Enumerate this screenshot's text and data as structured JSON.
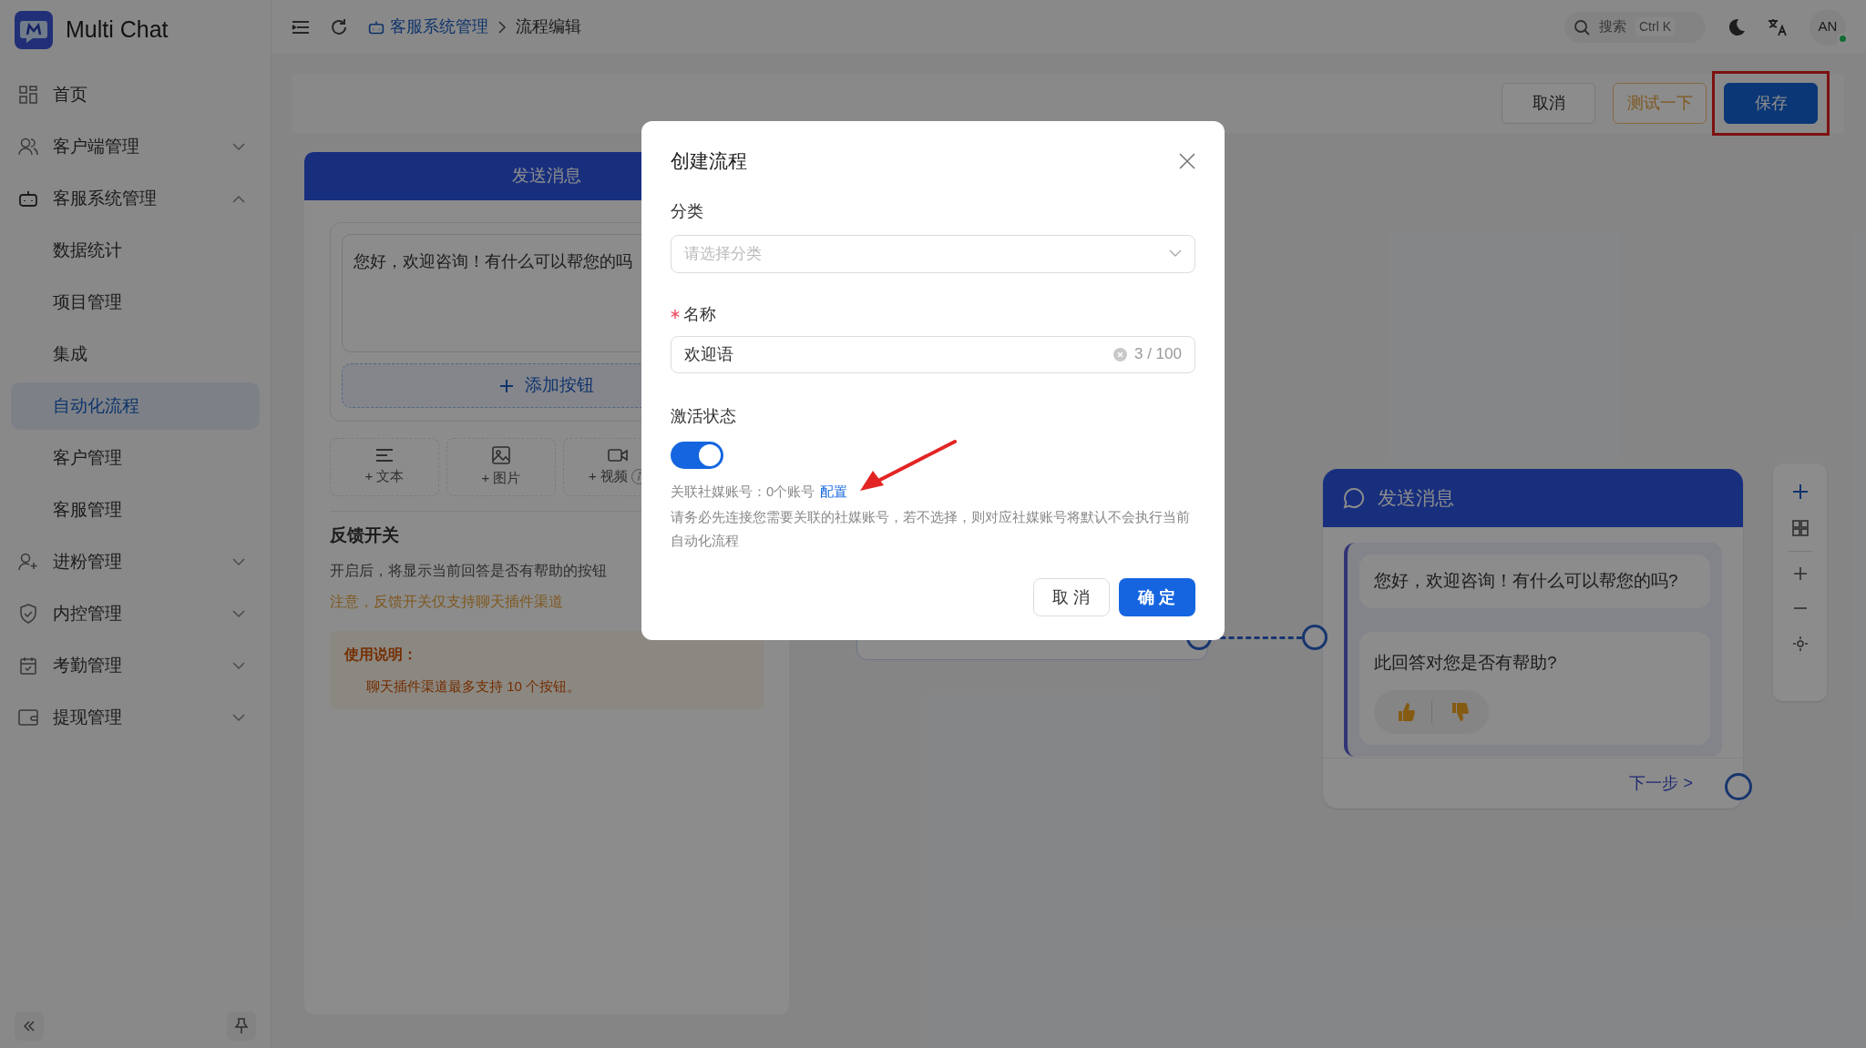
{
  "app": {
    "name": "Multi Chat"
  },
  "sidebar": {
    "items": [
      {
        "label": "首页"
      },
      {
        "label": "客户端管理",
        "expanded": false
      },
      {
        "label": "客服系统管理",
        "expanded": true,
        "children": [
          {
            "label": "数据统计",
            "selected": false
          },
          {
            "label": "项目管理",
            "selected": false
          },
          {
            "label": "集成",
            "selected": false
          },
          {
            "label": "自动化流程",
            "selected": true
          },
          {
            "label": "客户管理",
            "selected": false
          },
          {
            "label": "客服管理",
            "selected": false
          }
        ]
      },
      {
        "label": "进粉管理",
        "expanded": false
      },
      {
        "label": "内控管理",
        "expanded": false
      },
      {
        "label": "考勤管理",
        "expanded": false
      },
      {
        "label": "提现管理",
        "expanded": false
      }
    ]
  },
  "topbar": {
    "breadcrumb": [
      {
        "label": "客服系统管理",
        "link": true
      },
      {
        "label": "流程编辑",
        "link": false
      }
    ],
    "search": {
      "placeholder": "搜索",
      "shortcut": "Ctrl K"
    },
    "avatar": "AN"
  },
  "toolbar": {
    "buttons": [
      {
        "label": "取消",
        "kind": "plain",
        "highlighted": false
      },
      {
        "label": "测试一下",
        "kind": "warning",
        "highlighted": false
      },
      {
        "label": "保存",
        "kind": "primary",
        "highlighted": true
      }
    ]
  },
  "editor": {
    "title": "发送消息",
    "message": "您好，欢迎咨询！有什么可以帮您的吗",
    "add_button": "添加按钮",
    "media": [
      {
        "label": "+ 文本",
        "kind": "text",
        "info": false
      },
      {
        "label": "+ 图片",
        "kind": "image",
        "info": false
      },
      {
        "label": "+ 视频",
        "kind": "video",
        "info": true
      }
    ],
    "feedback": {
      "title": "反馈开关",
      "description": "开启后，将显示当前回答是否有帮助的按钮",
      "warning": "注意，反馈开关仅支持聊天插件渠道"
    },
    "usage": {
      "title": "使用说明：",
      "items": [
        "聊天插件渠道最多支持 10 个按钮。"
      ]
    }
  },
  "canvas": {
    "node": {
      "title": "发送消息",
      "message": "您好，欢迎咨询！有什么可以帮您的吗?",
      "question": "此回答对您是否有帮助?",
      "next": "下一步 >"
    }
  },
  "dialog": {
    "title": "创建流程",
    "category": {
      "label": "分类",
      "placeholder": "请选择分类"
    },
    "name": {
      "label": "名称",
      "required": true,
      "value": "欢迎语",
      "count": "3 / 100"
    },
    "status": {
      "label": "激活状态",
      "on": true
    },
    "accounts": {
      "text": "关联社媒账号：0个账号",
      "link": "配置"
    },
    "note": "请务必先连接您需要关联的社媒账号，若不选择，则对应社媒账号将默认不会执行当前自动化流程",
    "buttons": [
      {
        "label": "取 消",
        "kind": "plain"
      },
      {
        "label": "确 定",
        "kind": "primary"
      }
    ]
  }
}
